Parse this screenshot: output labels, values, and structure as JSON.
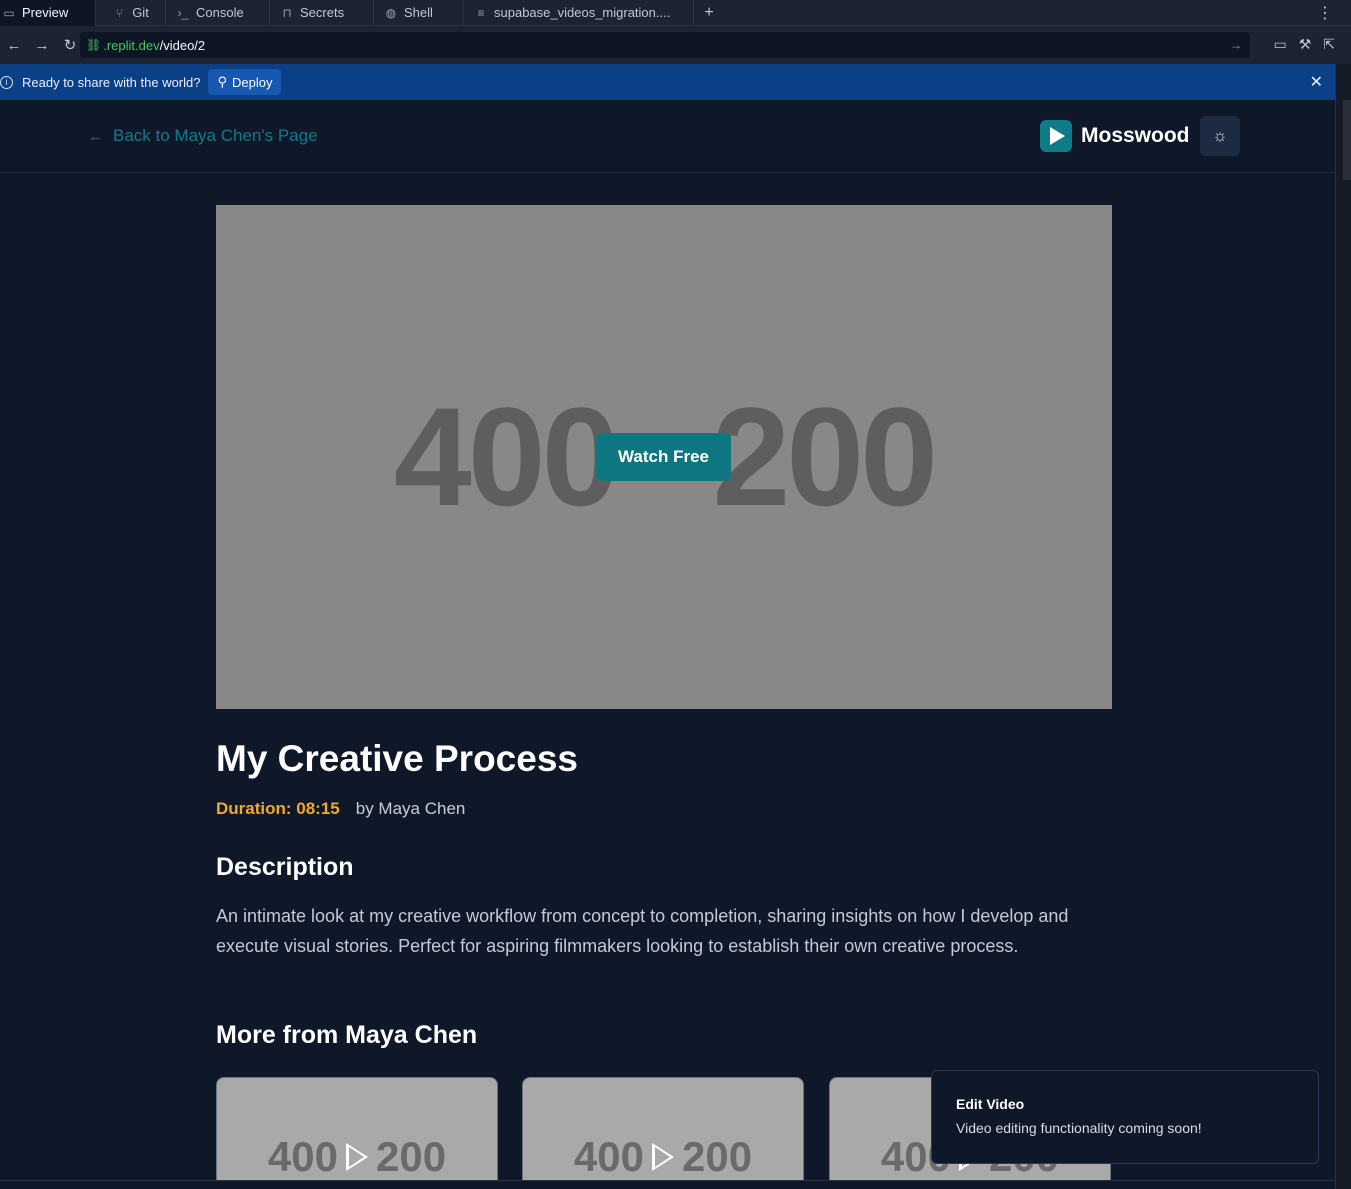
{
  "ide": {
    "tabs": [
      {
        "label": "Preview",
        "icon": "monitor-icon"
      },
      {
        "label": "Git",
        "icon": "git-icon"
      },
      {
        "label": "Console",
        "icon": "terminal-icon"
      },
      {
        "label": "Secrets",
        "icon": "lock-icon"
      },
      {
        "label": "Shell",
        "icon": "shell-icon"
      },
      {
        "label": "supabase_videos_migration....",
        "icon": "database-icon"
      }
    ],
    "add_tab": "+",
    "more": "⋮",
    "url": {
      "host": ".replit.dev",
      "path": "/video/2"
    },
    "banner": {
      "text": "Ready to share with the world?",
      "deploy_label": "Deploy"
    }
  },
  "header": {
    "back_label": "Back to Maya Chen's Page",
    "brand_name": "Mosswood"
  },
  "video": {
    "placeholder_w": "400",
    "placeholder_x": "×",
    "placeholder_h": "200",
    "watch_label": "Watch Free",
    "title": "My Creative Process",
    "duration": "Duration: 08:15",
    "byline": "by Maya Chen"
  },
  "description": {
    "heading": "Description",
    "text": "An intimate look at my creative workflow from concept to completion, sharing insights on how I develop and execute visual stories. Perfect for aspiring filmmakers looking to establish their own creative process."
  },
  "more": {
    "heading": "More from Maya Chen",
    "cards": [
      {
        "w": "400",
        "h": "200"
      },
      {
        "w": "400",
        "h": "200"
      },
      {
        "w": "400",
        "h": "200"
      }
    ]
  },
  "toast": {
    "title": "Edit Video",
    "body": "Video editing functionality coming soon!"
  },
  "colors": {
    "accent": "#0e7680",
    "duration": "#f0a830",
    "background": "#0f1828",
    "banner": "#0b3f86"
  }
}
